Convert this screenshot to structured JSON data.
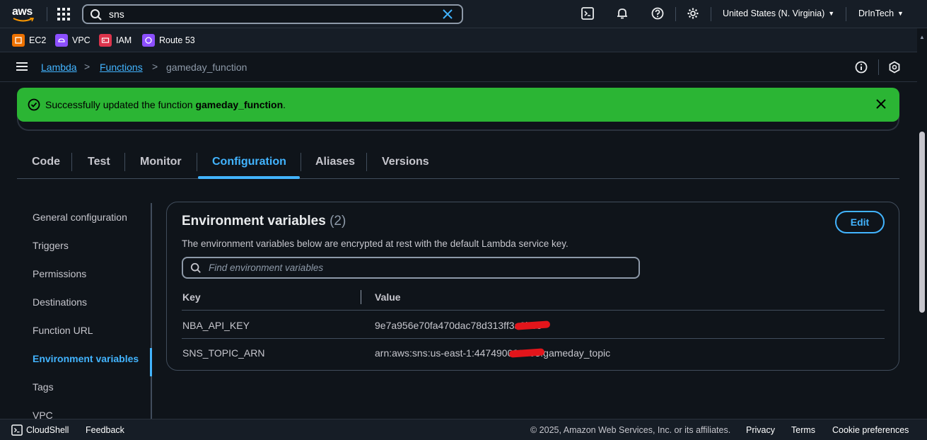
{
  "topnav": {
    "logo": "aws",
    "search_value": "sns",
    "region": "United States (N. Virginia)",
    "user": "DrInTech",
    "icons": [
      "cloudshell-icon",
      "bell-icon",
      "help-icon",
      "gear-icon"
    ]
  },
  "favorites": [
    {
      "label": "EC2",
      "color": "#ed7100"
    },
    {
      "label": "VPC",
      "color": "#8c4fff"
    },
    {
      "label": "IAM",
      "color": "#dd344c"
    },
    {
      "label": "Route 53",
      "color": "#8c4fff"
    }
  ],
  "breadcrumb": {
    "lambda": "Lambda",
    "functions": "Functions",
    "current": "gameday_function"
  },
  "flash": {
    "prefix": "Successfully updated the function ",
    "name": "gameday_function",
    "suffix": ".",
    "color": "#2bb534"
  },
  "tabs": [
    "Code",
    "Test",
    "Monitor",
    "Configuration",
    "Aliases",
    "Versions"
  ],
  "sidemenu": [
    "General configuration",
    "Triggers",
    "Permissions",
    "Destinations",
    "Function URL",
    "Environment variables",
    "Tags",
    "VPC"
  ],
  "env": {
    "title": "Environment variables",
    "count": "(2)",
    "description": "The environment variables below are encrypted at rest with the default Lambda service key.",
    "edit_label": "Edit",
    "filter_placeholder": "Find environment variables",
    "columns": {
      "key": "Key",
      "value": "Value"
    },
    "rows": [
      {
        "key": "NBA_API_KEY",
        "value": "9e7a956e70fa470dac78d313ff3a9bb5"
      },
      {
        "key": "SNS_TOPIC_ARN",
        "value": "arn:aws:sns:us-east-1:447490000003:gameday_topic"
      }
    ]
  },
  "footer": {
    "cloudshell": "CloudShell",
    "feedback": "Feedback",
    "copyright": "© 2025, Amazon Web Services, Inc. or its affiliates.",
    "privacy": "Privacy",
    "terms": "Terms",
    "cookies": "Cookie preferences"
  },
  "accent_color": "#42b4ff"
}
